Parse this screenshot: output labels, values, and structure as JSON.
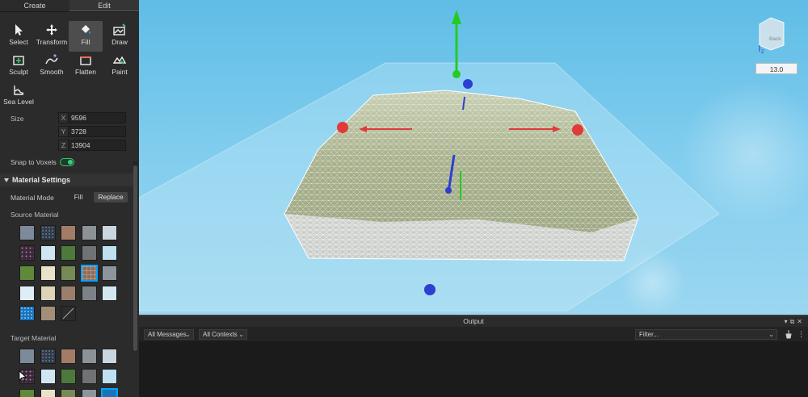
{
  "tabs": [
    {
      "label": "Create"
    },
    {
      "label": "Edit"
    }
  ],
  "tools": [
    {
      "label": "Select",
      "icon": "cursor-icon"
    },
    {
      "label": "Transform",
      "icon": "move-arrows-icon"
    },
    {
      "label": "Fill",
      "icon": "paint-bucket-icon"
    },
    {
      "label": "Draw",
      "icon": "draw-terrain-icon"
    },
    {
      "label": "Sculpt",
      "icon": "sculpt-icon"
    },
    {
      "label": "Smooth",
      "icon": "smooth-icon"
    },
    {
      "label": "Flatten",
      "icon": "flatten-icon"
    },
    {
      "label": "Paint",
      "icon": "paint-terrain-icon"
    },
    {
      "label": "Sea Level",
      "icon": "sea-level-icon"
    }
  ],
  "size": {
    "label": "Size",
    "x_axis": "X",
    "x": "9596",
    "y_axis": "Y",
    "y": "3728",
    "z_axis": "Z",
    "z": "13904"
  },
  "snap": {
    "label": "Snap to Voxels",
    "enabled": true
  },
  "material_settings": {
    "header": "Material Settings",
    "mode_label": "Material Mode",
    "mode_fill": "Fill",
    "mode_replace": "Replace",
    "source_label": "Source Material",
    "target_label": "Target Material"
  },
  "viewport": {
    "view_cube_label": "Back",
    "view_cube_axis": "Z",
    "camera_value": "13.0"
  },
  "output": {
    "title": "Output",
    "messages_filter": "All Messages",
    "contexts_filter": "All Contexts",
    "filter_placeholder": "Filter..."
  },
  "colors": {
    "accent": "#00a2ff",
    "toggle_on": "#36d07c",
    "gizmo_x": "#e03a3a",
    "gizmo_y": "#22cc22",
    "gizmo_z": "#2d3fd0",
    "sky": "#6cc4e6"
  }
}
